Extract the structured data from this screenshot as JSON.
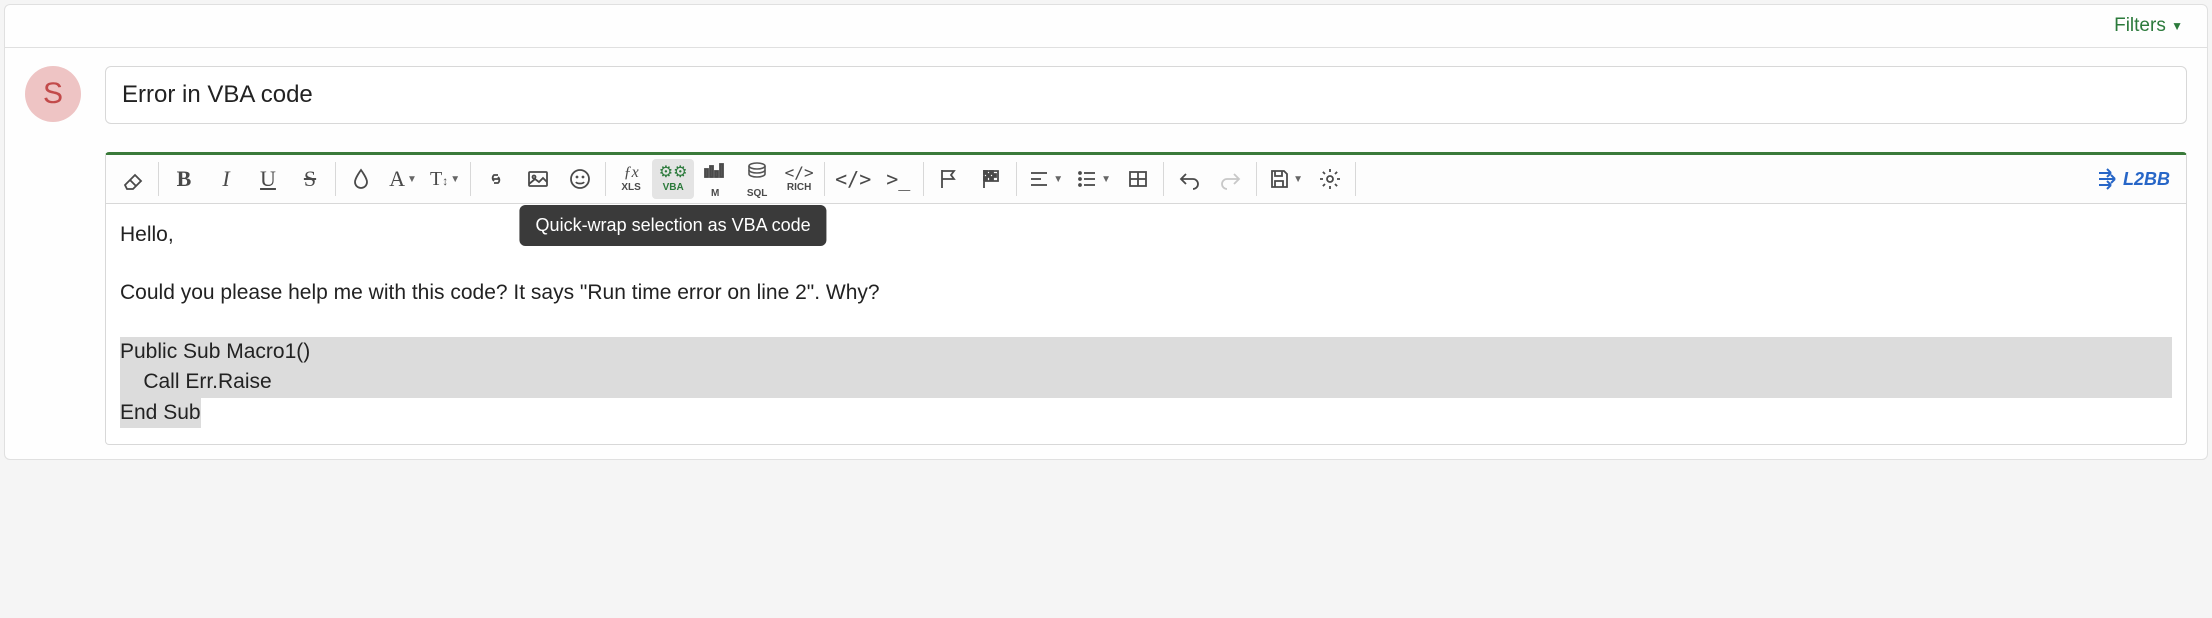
{
  "header": {
    "filters_label": "Filters"
  },
  "avatar": {
    "letter": "S"
  },
  "title": {
    "value": "Error in VBA code"
  },
  "toolbar": {
    "vba_tooltip": "Quick-wrap selection as VBA code",
    "code_buttons": {
      "xls": "XLS",
      "vba": "VBA",
      "m": "M",
      "sql": "SQL",
      "rich": "RICH"
    },
    "xl2bb": "L2BB"
  },
  "editor": {
    "line1": "Hello,",
    "line2": "Could you please help me with this code? It says \"Run time error on line 2\". Why?",
    "code1": "Public Sub Macro1()",
    "code2": "    Call Err.Raise",
    "code3": "End Sub"
  }
}
